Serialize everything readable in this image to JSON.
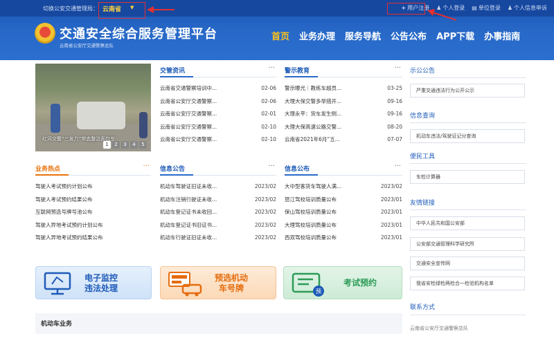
{
  "topbar": {
    "switch_text": "切换公安交通管理局：",
    "province": "云南省",
    "links": [
      "用户注册",
      "个人登录",
      "单位登录",
      "个人信息申诉"
    ]
  },
  "brand": {
    "title": "交通安全综合服务管理平台",
    "subtitle": "云南省公安厅交通警察总队"
  },
  "nav": [
    "首页",
    "业务办理",
    "服务导航",
    "公告公布",
    "APP下载",
    "办事指南"
  ],
  "slider": {
    "caption": "红河交警“三发力”常态整治面包车",
    "dots": [
      "1",
      "2",
      "3",
      "4",
      "5"
    ]
  },
  "columns": [
    {
      "title": "交管资讯",
      "rows": [
        {
          "text": "云南省交通警察培训中...",
          "date": "02-06"
        },
        {
          "text": "云南省公安厅交通警察...",
          "date": "02-06"
        },
        {
          "text": "云南省公安厅交通警察...",
          "date": "02-01"
        },
        {
          "text": "云南省公安厅交通警察...",
          "date": "02-10"
        },
        {
          "text": "云南省公安厅交通警察...",
          "date": "02-10"
        }
      ]
    },
    {
      "title": "警示教育",
      "rows": [
        {
          "text": "警示曝光｜教练车超员...",
          "date": "03-25"
        },
        {
          "text": "大理大保交警多举措开...",
          "date": "09-16"
        },
        {
          "text": "大理永平：货车发生侧...",
          "date": "09-16"
        },
        {
          "text": "大理大保高速公路交警...",
          "date": "08-20"
        },
        {
          "text": "云南省2021年6月“五...",
          "date": "07-07"
        }
      ]
    },
    {
      "title": "业务热点",
      "rows": [
        {
          "text": "驾驶人考试预约计划公布",
          "date": ""
        },
        {
          "text": "驾驶人考试预约结果公布",
          "date": ""
        },
        {
          "text": "互联网预选号牌号池公布",
          "date": ""
        },
        {
          "text": "驾驶人异地考试预约计划公布",
          "date": ""
        },
        {
          "text": "驾驶人异地考试预约结果公布",
          "date": ""
        }
      ]
    },
    {
      "title": "信息公告",
      "rows": [
        {
          "text": "机动车驾驶证旧证未收...",
          "date": "2023/02"
        },
        {
          "text": "机动车注销行驶证未收...",
          "date": "2023/02"
        },
        {
          "text": "机动车登记证书未收回...",
          "date": "2023/02"
        },
        {
          "text": "机动车登记证书旧证书...",
          "date": "2023/02"
        },
        {
          "text": "机动车行驶证旧证未收...",
          "date": "2023/02"
        }
      ]
    },
    {
      "title": "信息公布",
      "rows": [
        {
          "text": "大中型客货车驾驶人满...",
          "date": "2023/02"
        },
        {
          "text": "怒江驾校培训质量公布",
          "date": "2023/01"
        },
        {
          "text": "保山驾校培训质量公布",
          "date": "2023/01"
        },
        {
          "text": "大理驾校培训质量公布",
          "date": "2023/01"
        },
        {
          "text": "西双驾校培训质量公布",
          "date": "2023/01"
        }
      ]
    }
  ],
  "more_label": "···",
  "right": {
    "notice_title": "示公公告",
    "notice_item": "严重交通违法行为公开公示",
    "query_title": "信息查询",
    "query_item": "机动车违法/驾驶证记分查询",
    "tools_title": "便民工具",
    "tools_item": "车检计算器",
    "links_title": "友情链接",
    "links": [
      "中华人民共和国公安部",
      "公安部交通管理科学研究所",
      "交通安全宣传网",
      "我省安检绿检两检合一检验机构名单"
    ],
    "contact_title": "联系方式",
    "contact_text": "云南省公安厅交通警察总队"
  },
  "services": [
    {
      "line1": "电子监控",
      "line2": "违法处理"
    },
    {
      "line1": "预选机动",
      "line2": "车号牌"
    },
    {
      "line1": "考试预约",
      "line2": ""
    }
  ],
  "bottom_title": "机动车业务",
  "colors": {
    "brand_blue": "#2869c8",
    "accent_yellow": "#ffc21a",
    "accent_orange": "#e8730c",
    "highlight_red": "#e23030"
  }
}
